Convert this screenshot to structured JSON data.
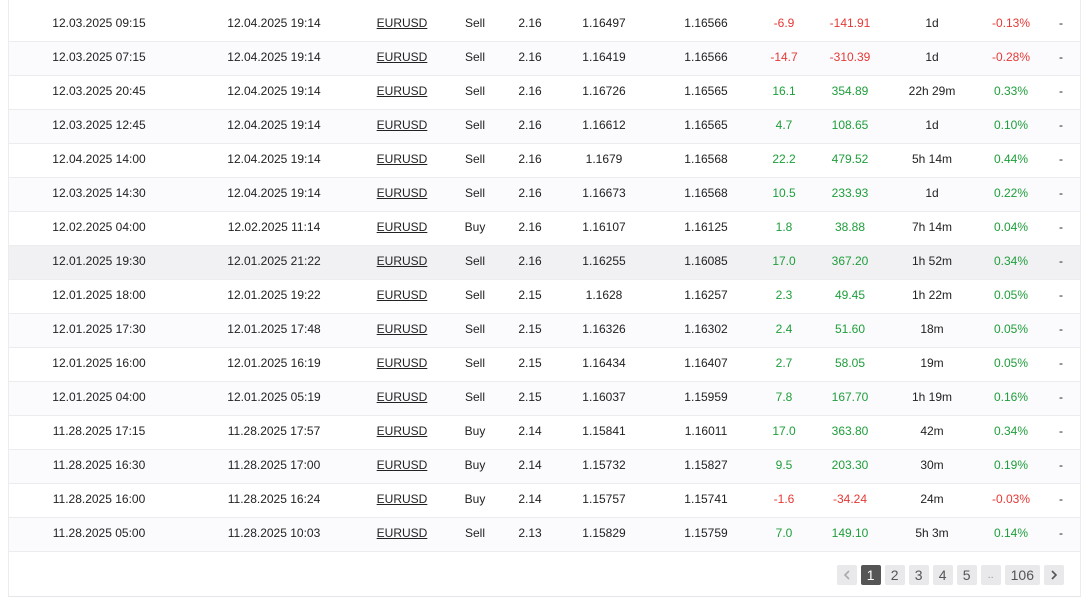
{
  "trades": [
    {
      "open_time": "12.03.2025 09:15",
      "close_time": "12.04.2025 19:14",
      "symbol": "EURUSD",
      "type": "Sell",
      "volume": "2.16",
      "open_price": "1.16497",
      "close_price": "1.16566",
      "pips": "-6.9",
      "profit": "-141.91",
      "duration": "1d",
      "gain": "-0.13%",
      "extra": "-",
      "dir": "neg"
    },
    {
      "open_time": "12.03.2025 07:15",
      "close_time": "12.04.2025 19:14",
      "symbol": "EURUSD",
      "type": "Sell",
      "volume": "2.16",
      "open_price": "1.16419",
      "close_price": "1.16566",
      "pips": "-14.7",
      "profit": "-310.39",
      "duration": "1d",
      "gain": "-0.28%",
      "extra": "-",
      "dir": "neg"
    },
    {
      "open_time": "12.03.2025 20:45",
      "close_time": "12.04.2025 19:14",
      "symbol": "EURUSD",
      "type": "Sell",
      "volume": "2.16",
      "open_price": "1.16726",
      "close_price": "1.16565",
      "pips": "16.1",
      "profit": "354.89",
      "duration": "22h 29m",
      "gain": "0.33%",
      "extra": "-",
      "dir": "pos"
    },
    {
      "open_time": "12.03.2025 12:45",
      "close_time": "12.04.2025 19:14",
      "symbol": "EURUSD",
      "type": "Sell",
      "volume": "2.16",
      "open_price": "1.16612",
      "close_price": "1.16565",
      "pips": "4.7",
      "profit": "108.65",
      "duration": "1d",
      "gain": "0.10%",
      "extra": "-",
      "dir": "pos"
    },
    {
      "open_time": "12.04.2025 14:00",
      "close_time": "12.04.2025 19:14",
      "symbol": "EURUSD",
      "type": "Sell",
      "volume": "2.16",
      "open_price": "1.1679",
      "close_price": "1.16568",
      "pips": "22.2",
      "profit": "479.52",
      "duration": "5h 14m",
      "gain": "0.44%",
      "extra": "-",
      "dir": "pos"
    },
    {
      "open_time": "12.03.2025 14:30",
      "close_time": "12.04.2025 19:14",
      "symbol": "EURUSD",
      "type": "Sell",
      "volume": "2.16",
      "open_price": "1.16673",
      "close_price": "1.16568",
      "pips": "10.5",
      "profit": "233.93",
      "duration": "1d",
      "gain": "0.22%",
      "extra": "-",
      "dir": "pos"
    },
    {
      "open_time": "12.02.2025 04:00",
      "close_time": "12.02.2025 11:14",
      "symbol": "EURUSD",
      "type": "Buy",
      "volume": "2.16",
      "open_price": "1.16107",
      "close_price": "1.16125",
      "pips": "1.8",
      "profit": "38.88",
      "duration": "7h 14m",
      "gain": "0.04%",
      "extra": "-",
      "dir": "pos"
    },
    {
      "open_time": "12.01.2025 19:30",
      "close_time": "12.01.2025 21:22",
      "symbol": "EURUSD",
      "type": "Sell",
      "volume": "2.16",
      "open_price": "1.16255",
      "close_price": "1.16085",
      "pips": "17.0",
      "profit": "367.20",
      "duration": "1h 52m",
      "gain": "0.34%",
      "extra": "-",
      "dir": "pos"
    },
    {
      "open_time": "12.01.2025 18:00",
      "close_time": "12.01.2025 19:22",
      "symbol": "EURUSD",
      "type": "Sell",
      "volume": "2.15",
      "open_price": "1.1628",
      "close_price": "1.16257",
      "pips": "2.3",
      "profit": "49.45",
      "duration": "1h 22m",
      "gain": "0.05%",
      "extra": "-",
      "dir": "pos"
    },
    {
      "open_time": "12.01.2025 17:30",
      "close_time": "12.01.2025 17:48",
      "symbol": "EURUSD",
      "type": "Sell",
      "volume": "2.15",
      "open_price": "1.16326",
      "close_price": "1.16302",
      "pips": "2.4",
      "profit": "51.60",
      "duration": "18m",
      "gain": "0.05%",
      "extra": "-",
      "dir": "pos"
    },
    {
      "open_time": "12.01.2025 16:00",
      "close_time": "12.01.2025 16:19",
      "symbol": "EURUSD",
      "type": "Sell",
      "volume": "2.15",
      "open_price": "1.16434",
      "close_price": "1.16407",
      "pips": "2.7",
      "profit": "58.05",
      "duration": "19m",
      "gain": "0.05%",
      "extra": "-",
      "dir": "pos"
    },
    {
      "open_time": "12.01.2025 04:00",
      "close_time": "12.01.2025 05:19",
      "symbol": "EURUSD",
      "type": "Sell",
      "volume": "2.15",
      "open_price": "1.16037",
      "close_price": "1.15959",
      "pips": "7.8",
      "profit": "167.70",
      "duration": "1h 19m",
      "gain": "0.16%",
      "extra": "-",
      "dir": "pos"
    },
    {
      "open_time": "11.28.2025 17:15",
      "close_time": "11.28.2025 17:57",
      "symbol": "EURUSD",
      "type": "Buy",
      "volume": "2.14",
      "open_price": "1.15841",
      "close_price": "1.16011",
      "pips": "17.0",
      "profit": "363.80",
      "duration": "42m",
      "gain": "0.34%",
      "extra": "-",
      "dir": "pos"
    },
    {
      "open_time": "11.28.2025 16:30",
      "close_time": "11.28.2025 17:00",
      "symbol": "EURUSD",
      "type": "Buy",
      "volume": "2.14",
      "open_price": "1.15732",
      "close_price": "1.15827",
      "pips": "9.5",
      "profit": "203.30",
      "duration": "30m",
      "gain": "0.19%",
      "extra": "-",
      "dir": "pos"
    },
    {
      "open_time": "11.28.2025 16:00",
      "close_time": "11.28.2025 16:24",
      "symbol": "EURUSD",
      "type": "Buy",
      "volume": "2.14",
      "open_price": "1.15757",
      "close_price": "1.15741",
      "pips": "-1.6",
      "profit": "-34.24",
      "duration": "24m",
      "gain": "-0.03%",
      "extra": "-",
      "dir": "neg"
    },
    {
      "open_time": "11.28.2025 05:00",
      "close_time": "11.28.2025 10:03",
      "symbol": "EURUSD",
      "type": "Sell",
      "volume": "2.13",
      "open_price": "1.15829",
      "close_price": "1.15759",
      "pips": "7.0",
      "profit": "149.10",
      "duration": "5h 3m",
      "gain": "0.14%",
      "extra": "-",
      "dir": "pos"
    }
  ],
  "highlighted_row": 7,
  "pagination": {
    "prev_icon": "chevron-left-icon",
    "next_icon": "chevron-right-icon",
    "pages": [
      "1",
      "2",
      "3",
      "4",
      "5"
    ],
    "current": "1",
    "ellipsis": "..",
    "last": "106"
  },
  "colors": {
    "positive": "#1e9e3a",
    "negative": "#e53935",
    "active_page": "#555555"
  }
}
